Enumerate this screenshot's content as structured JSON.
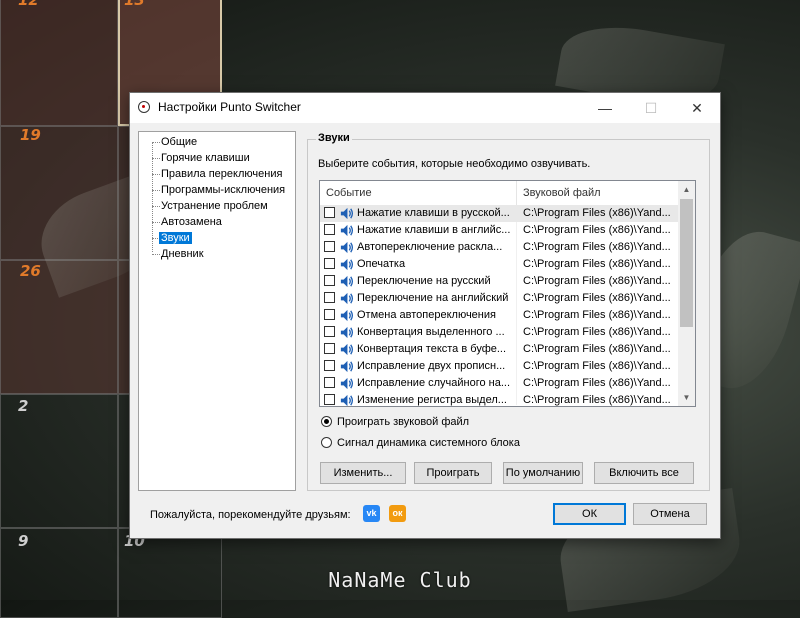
{
  "background": {
    "calendar_days": [
      "12",
      "13",
      "19",
      "26",
      "2",
      "9",
      "10"
    ],
    "watermark": "NaNaMe Club"
  },
  "window": {
    "title": "Настройки Punto Switcher",
    "minimize_glyph": "—",
    "maximize_glyph": "☐",
    "close_glyph": "✕"
  },
  "tree": {
    "items": [
      "Общие",
      "Горячие клавиши",
      "Правила переключения",
      "Программы-исключения",
      "Устранение проблем",
      "Автозамена",
      "Звуки",
      "Дневник"
    ],
    "selected": "Звуки"
  },
  "sounds": {
    "group_title": "Звуки",
    "description": "Выберите события, которые необходимо озвучивать.",
    "columns": [
      "Событие",
      "Звуковой файл"
    ],
    "rows": [
      {
        "event": "Нажатие клавиши в русской...",
        "file": "C:\\Program Files (x86)\\Yand..."
      },
      {
        "event": "Нажатие клавиши в английс...",
        "file": "C:\\Program Files (x86)\\Yand..."
      },
      {
        "event": "Автопереключение раскла...",
        "file": "C:\\Program Files (x86)\\Yand..."
      },
      {
        "event": "Опечатка",
        "file": "C:\\Program Files (x86)\\Yand..."
      },
      {
        "event": "Переключение на русский",
        "file": "C:\\Program Files (x86)\\Yand..."
      },
      {
        "event": "Переключение на английский",
        "file": "C:\\Program Files (x86)\\Yand..."
      },
      {
        "event": "Отмена автопереключения",
        "file": "C:\\Program Files (x86)\\Yand..."
      },
      {
        "event": "Конвертация выделенного ...",
        "file": "C:\\Program Files (x86)\\Yand..."
      },
      {
        "event": "Конвертация текста в буфе...",
        "file": "C:\\Program Files (x86)\\Yand..."
      },
      {
        "event": "Исправление двух прописн...",
        "file": "C:\\Program Files (x86)\\Yand..."
      },
      {
        "event": "Исправление случайного на...",
        "file": "C:\\Program Files (x86)\\Yand..."
      },
      {
        "event": "Изменение регистра выдел...",
        "file": "C:\\Program Files (x86)\\Yand..."
      }
    ],
    "scroll_up": "▲",
    "scroll_down": "▼",
    "radio_play_file": "Проиграть звуковой файл",
    "radio_beep": "Сигнал динамика системного блока",
    "btn_change": "Изменить...",
    "btn_play": "Проиграть",
    "btn_default": "По умолчанию",
    "btn_enable_all": "Включить все"
  },
  "footer": {
    "recommend_text": "Пожалуйста, порекомендуйте друзьям:",
    "vk_label": "vk",
    "ok_label": "ок",
    "ok_button": "ОК",
    "cancel_button": "Отмена"
  },
  "colors": {
    "selection": "#0078d7",
    "calendar_numbers": "#e07a2a",
    "vk": "#2787f5",
    "odnoklassniki": "#f29b0f"
  }
}
